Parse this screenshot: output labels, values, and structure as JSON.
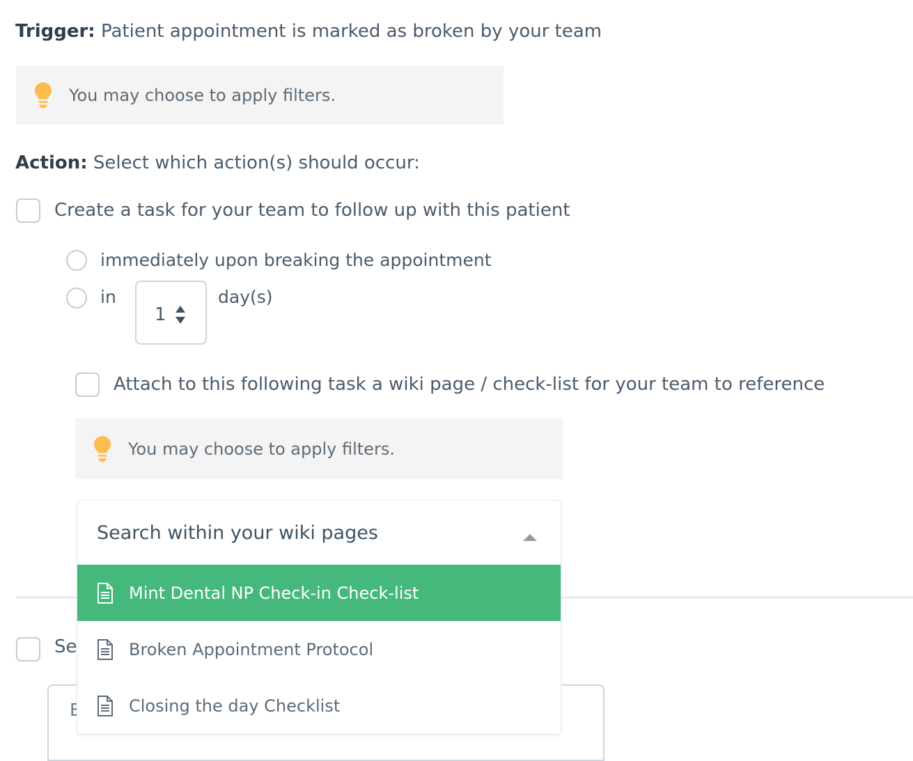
{
  "trigger": {
    "label": "Trigger:",
    "text": "Patient appointment is marked as broken by your team"
  },
  "tips": {
    "filters_hint": "You may choose to apply filters.",
    "bulb_icon": "lightbulb-icon",
    "bulb_color": "#fbbd4d"
  },
  "action": {
    "label": "Action:",
    "text": "Select which action(s) should occur:"
  },
  "create_task": {
    "checkbox_label": "Create a task for your team to follow up with this patient",
    "checked": false,
    "timing_options": [
      {
        "label": "immediately upon breaking the appointment",
        "selected": false
      },
      {
        "label": "in",
        "selected": false
      }
    ],
    "day_stepper": {
      "value": "1",
      "suffix_label": "day(s)",
      "arrows_icon": "stepper-arrows-icon"
    }
  },
  "attach_wiki": {
    "checkbox_label": "Attach to this following task a wiki page / check-list for your team to reference",
    "checked": false
  },
  "wiki_dropdown": {
    "placeholder": "Search within your wiki pages",
    "value": "",
    "expanded": true,
    "caret_icon": "caret-up-icon",
    "highlight_color": "#45b87c",
    "options": [
      {
        "label": "Mint Dental NP Check-in Check-list",
        "icon": "document-icon",
        "highlighted": true
      },
      {
        "label": "Broken Appointment Protocol",
        "icon": "document-icon",
        "highlighted": false
      },
      {
        "label": "Closing the day Checklist",
        "icon": "document-icon",
        "highlighted": false
      }
    ]
  },
  "send_section": {
    "checkbox_label": "Se",
    "checked": false,
    "textarea_placeholder": "E"
  }
}
